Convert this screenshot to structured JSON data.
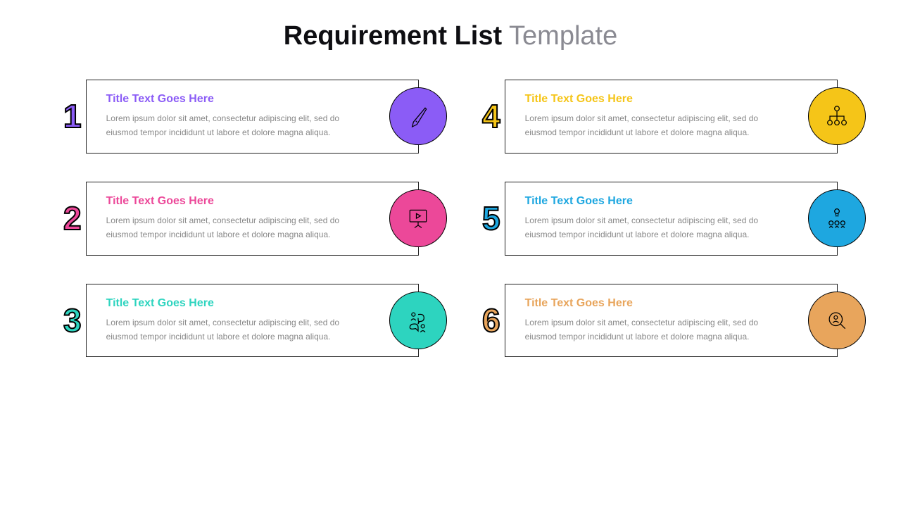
{
  "title": {
    "bold": "Requirement List",
    "light": " Template"
  },
  "items": [
    {
      "number": "1",
      "title": "Title Text Goes Here",
      "body": "Lorem ipsum dolor sit amet, consectetur adipiscing elit, sed do eiusmod tempor incididunt ut labore et dolore magna aliqua.",
      "color": "#8b5cf6",
      "icon": "pen"
    },
    {
      "number": "4",
      "title": "Title Text Goes Here",
      "body": "Lorem ipsum dolor sit amet, consectetur adipiscing elit, sed do eiusmod tempor incididunt ut labore et dolore magna aliqua.",
      "color": "#f5c518",
      "icon": "org"
    },
    {
      "number": "2",
      "title": "Title Text Goes Here",
      "body": "Lorem ipsum dolor sit amet, consectetur adipiscing elit, sed do eiusmod tempor incididunt ut labore et dolore magna aliqua.",
      "color": "#ec4899",
      "icon": "board"
    },
    {
      "number": "5",
      "title": "Title Text Goes Here",
      "body": "Lorem ipsum dolor sit amet, consectetur adipiscing elit, sed do eiusmod tempor incididunt ut labore et dolore magna aliqua.",
      "color": "#1ea7e0",
      "icon": "idea"
    },
    {
      "number": "3",
      "title": "Title Text Goes Here",
      "body": "Lorem ipsum dolor sit amet, consectetur adipiscing elit, sed do eiusmod tempor incididunt ut labore et dolore magna aliqua.",
      "color": "#2dd4bf",
      "icon": "chat"
    },
    {
      "number": "6",
      "title": "Title Text Goes Here",
      "body": "Lorem ipsum dolor sit amet, consectetur adipiscing elit, sed do eiusmod tempor incididunt ut labore et dolore magna aliqua.",
      "color": "#e8a55c",
      "icon": "search"
    }
  ]
}
